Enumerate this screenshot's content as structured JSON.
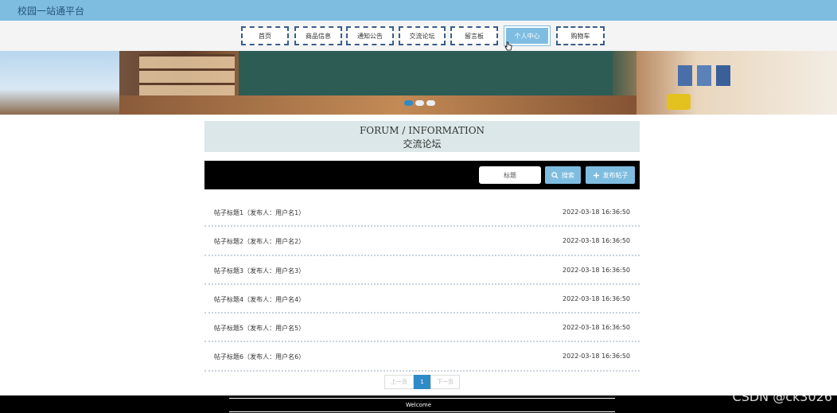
{
  "app": {
    "brand": "校园一站通平台"
  },
  "nav": [
    {
      "label": "首页"
    },
    {
      "label": "商品信息"
    },
    {
      "label": "通知公告"
    },
    {
      "label": "交流论坛"
    },
    {
      "label": "留言板"
    },
    {
      "label": "个人中心",
      "active": true
    },
    {
      "label": "购物车"
    }
  ],
  "banner": {
    "slides": 3,
    "active_slide": 1
  },
  "section": {
    "title_en": "FORUM / INFORMATION",
    "title_cn": "交流论坛"
  },
  "search": {
    "placeholder": "标题",
    "search_label": "搜索",
    "post_label": "发布帖子"
  },
  "posts": [
    {
      "title": "帖子标题1（发布人：用户名1）",
      "time": "2022-03-18 16:36:50"
    },
    {
      "title": "帖子标题2（发布人：用户名2）",
      "time": "2022-03-18 16:36:50"
    },
    {
      "title": "帖子标题3（发布人：用户名3）",
      "time": "2022-03-18 16:36:50"
    },
    {
      "title": "帖子标题4（发布人：用户名4）",
      "time": "2022-03-18 16:36:50"
    },
    {
      "title": "帖子标题5（发布人：用户名5）",
      "time": "2022-03-18 16:36:50"
    },
    {
      "title": "帖子标题6（发布人：用户名6）",
      "time": "2022-03-18 16:36:50"
    }
  ],
  "pagination": {
    "prev": "上一页",
    "current": "1",
    "next": "下一页"
  },
  "footer": {
    "text": "Welcome"
  },
  "watermark": "CSDN @ck3026",
  "colors": {
    "topbar": "#7fbde0",
    "accent": "#2f8bc7",
    "nav_border": "#3a5d8a",
    "title_bg": "#dbe7e8"
  }
}
